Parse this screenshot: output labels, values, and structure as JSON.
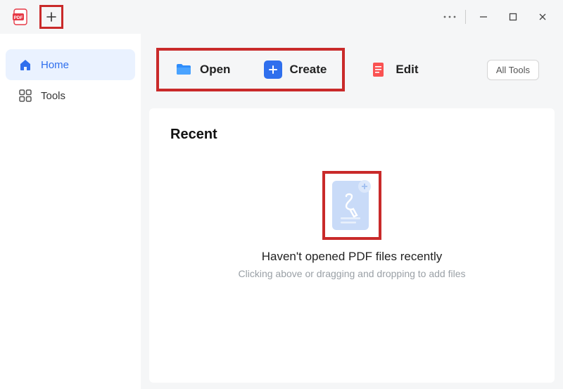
{
  "sidebar": {
    "items": [
      {
        "label": "Home",
        "icon": "home-icon"
      },
      {
        "label": "Tools",
        "icon": "tools-icon"
      }
    ]
  },
  "toolbar": {
    "open_label": "Open",
    "create_label": "Create",
    "edit_label": "Edit",
    "all_tools_label": "All Tools"
  },
  "recent": {
    "heading": "Recent",
    "empty_title": "Haven't opened PDF files recently",
    "empty_subtitle": "Clicking above or dragging and dropping to add files"
  },
  "colors": {
    "accent_blue": "#2f6fed",
    "accent_red": "#fa5252",
    "highlight_red": "#c92a2a"
  }
}
